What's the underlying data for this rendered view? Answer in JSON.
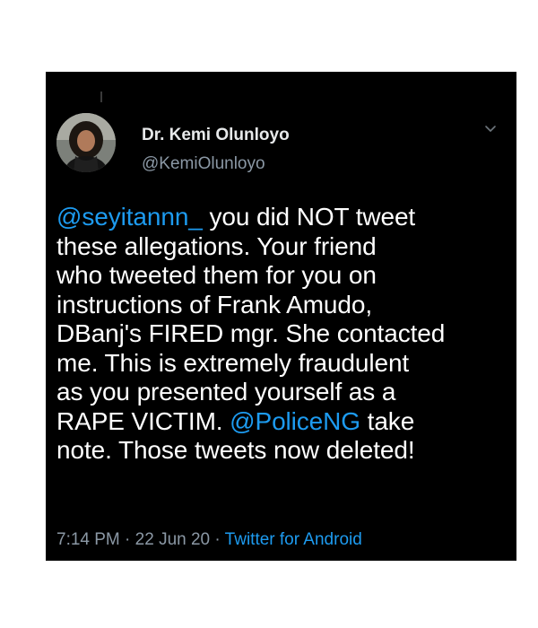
{
  "author": {
    "name": "Dr. Kemi Olunloyo",
    "handle": "@KemiOlunloyo",
    "avatar_icon": "profile-photo"
  },
  "tweet": {
    "lines": [
      {
        "mention": "@seyitannn_",
        "text": " you did NOT tweet"
      },
      {
        "text": "these allegations. Your friend"
      },
      {
        "text": "who tweeted them for you on"
      },
      {
        "text": "instructions of Frank Amudo,"
      },
      {
        "text": "DBanj's FIRED mgr. She contacted"
      },
      {
        "text": "me. This is extremely fraudulent"
      },
      {
        "text": "as you presented yourself as a"
      },
      {
        "text": "RAPE VICTIM. ",
        "mention": "@PoliceNG",
        "text_after": " take"
      },
      {
        "text": "note. Those tweets now deleted!"
      }
    ]
  },
  "meta": {
    "time": "7:14 PM",
    "sep1": " · ",
    "date": "22 Jun 20",
    "sep2": " · ",
    "source": "Twitter for Android"
  },
  "colors": {
    "background": "#000000",
    "text": "#ffffff",
    "mention": "#1d9bf0",
    "secondary": "#8b98a5"
  },
  "icons": {
    "menu": "chevron-down-icon"
  }
}
